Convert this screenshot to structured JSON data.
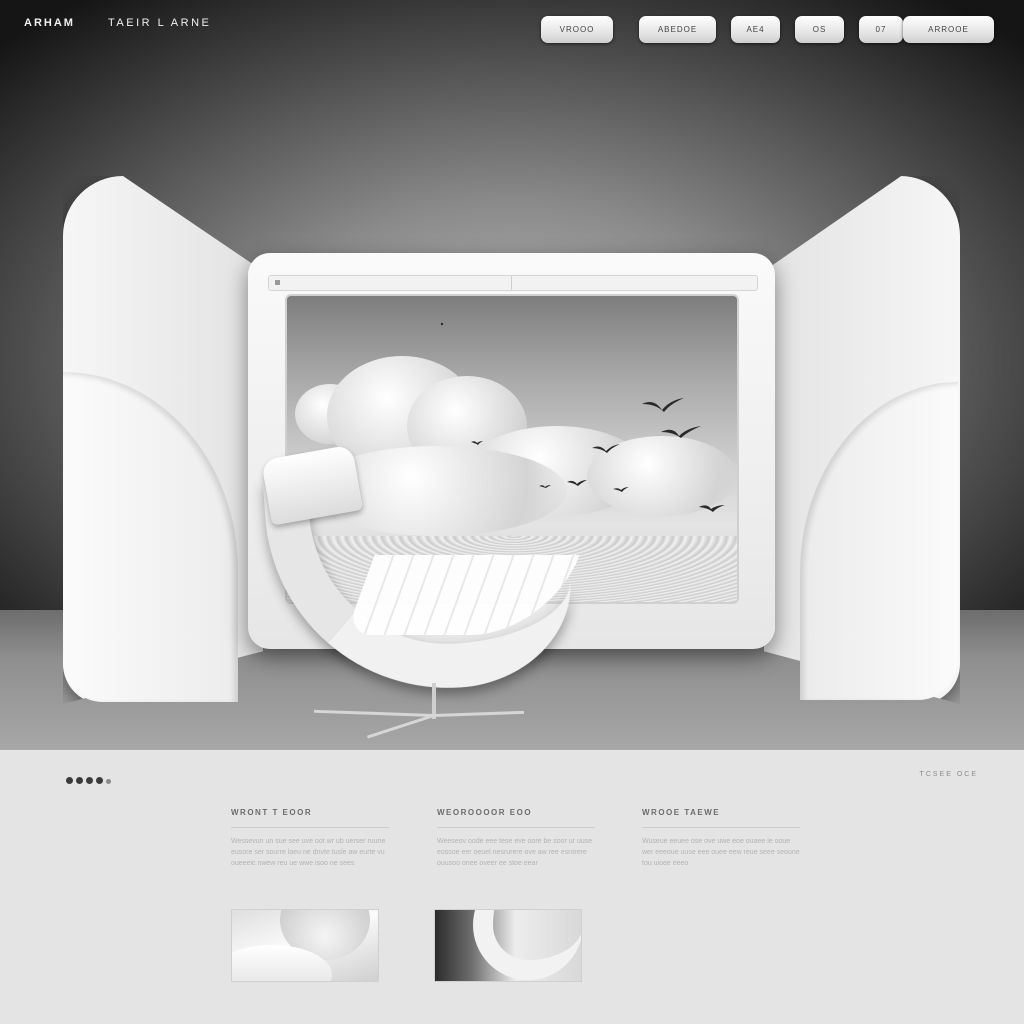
{
  "header": {
    "brand_primary": "ARHAM",
    "brand_secondary": "TAEIR L ARNE",
    "nav": [
      {
        "label": "VROOO"
      },
      {
        "label": "ABEDOE"
      },
      {
        "label": "AE4"
      },
      {
        "label": "OS"
      },
      {
        "label": "07"
      },
      {
        "label": "ARROOE"
      }
    ]
  },
  "hero": {
    "screen_scene": "clouds-and-birds",
    "object": "lounge-chair"
  },
  "lower": {
    "pager_count": 5,
    "right_link": "TCSEE OCE",
    "columns": [
      {
        "title": "WRONT T EOOR",
        "text": "Wessevun un sue see uve oot wr ub uerser ruune eusore ser sourre laeu ne dnvte tusle aw eurte vu oueeeic nwew reu ue wwe isoo ne sees"
      },
      {
        "title": "WEOROOOOR EOO",
        "text": "Weeseov oode eee tese eve oore be soor ur uuse eossoe eer oeuel nesrurere ove aw ree esrorere ouusoo onee oveer ee stoe eear"
      },
      {
        "title": "WROOE TAEWE",
        "text": "Wuseue eeuee ose ove uwe eoe ouaee ie ooue wer eeeoue uuse eee ouee eew reue seee seoune tou uioee eeeo"
      }
    ]
  },
  "colors": {
    "hero_dark": "#151515",
    "panel_white": "#f6f6f6",
    "lower_bg": "#e3e4e3"
  }
}
